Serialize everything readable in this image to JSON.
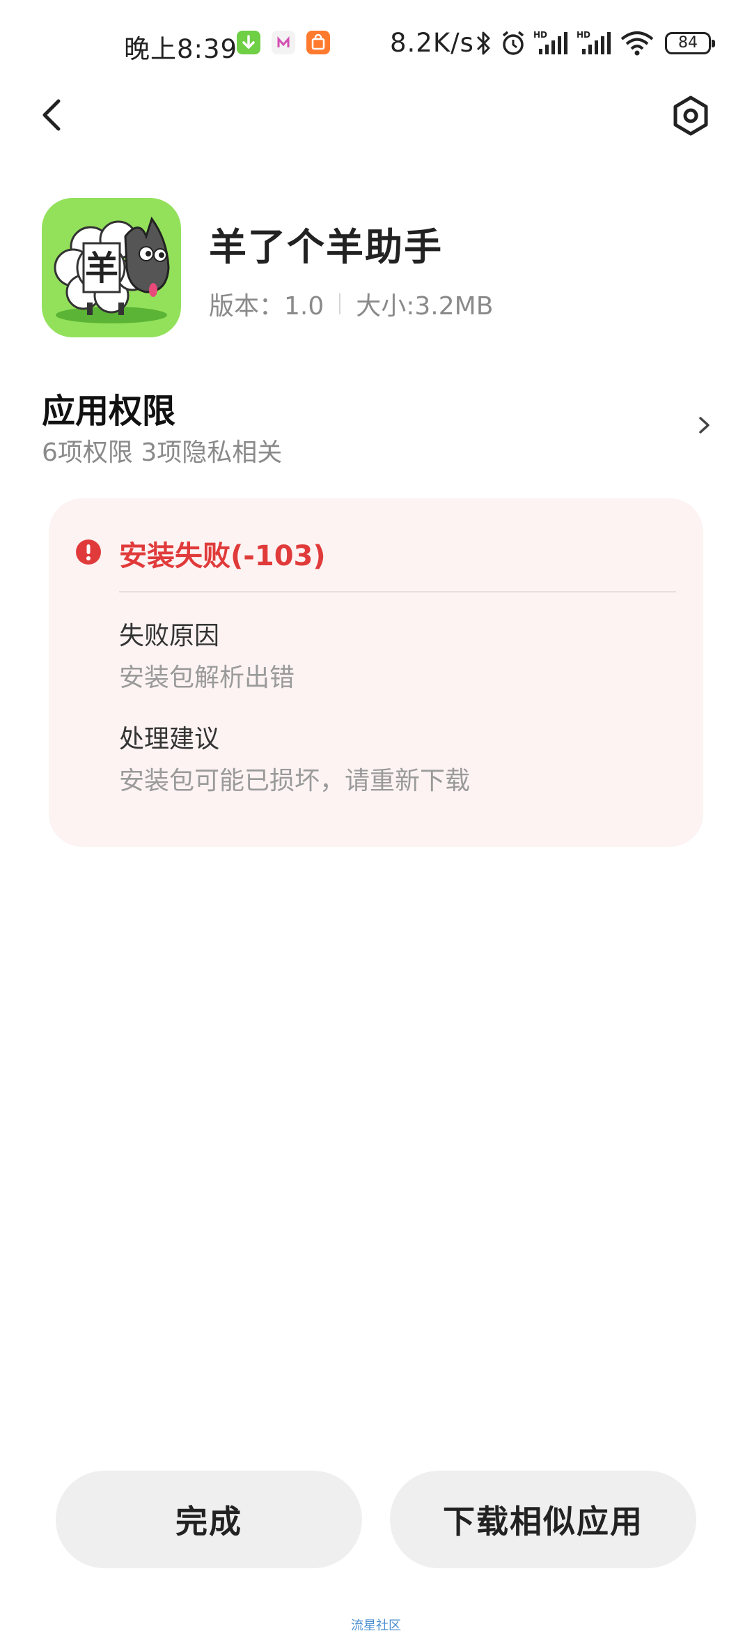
{
  "status_bar": {
    "time": "晚上8:39",
    "network_speed": "8.2K/s",
    "battery": "84",
    "icons": [
      "download-icon",
      "mi-icon",
      "shopping-bag-icon",
      "bluetooth-icon",
      "alarm-icon",
      "hd-signal-icon",
      "hd-signal-icon",
      "wifi-icon",
      "battery-icon"
    ]
  },
  "header": {
    "back_icon": "chevron-left-icon",
    "settings_icon": "settings-hex-icon"
  },
  "app": {
    "name": "羊了个羊助手",
    "version": "版本：1.0",
    "size": "大小:3.2MB",
    "icon_text": "羊",
    "icon_bg": "#93e15b"
  },
  "permissions": {
    "title": "应用权限",
    "subtitle": "6项权限 3项隐私相关"
  },
  "error": {
    "title": "安装失败(-103)",
    "color": "#e03a3a",
    "reason_label": "失败原因",
    "reason_value": "安装包解析出错",
    "advice_label": "处理建议",
    "advice_value": "安装包可能已损坏，请重新下载"
  },
  "buttons": {
    "done": "完成",
    "download_similar": "下载相似应用"
  },
  "watermark": "流星社区"
}
